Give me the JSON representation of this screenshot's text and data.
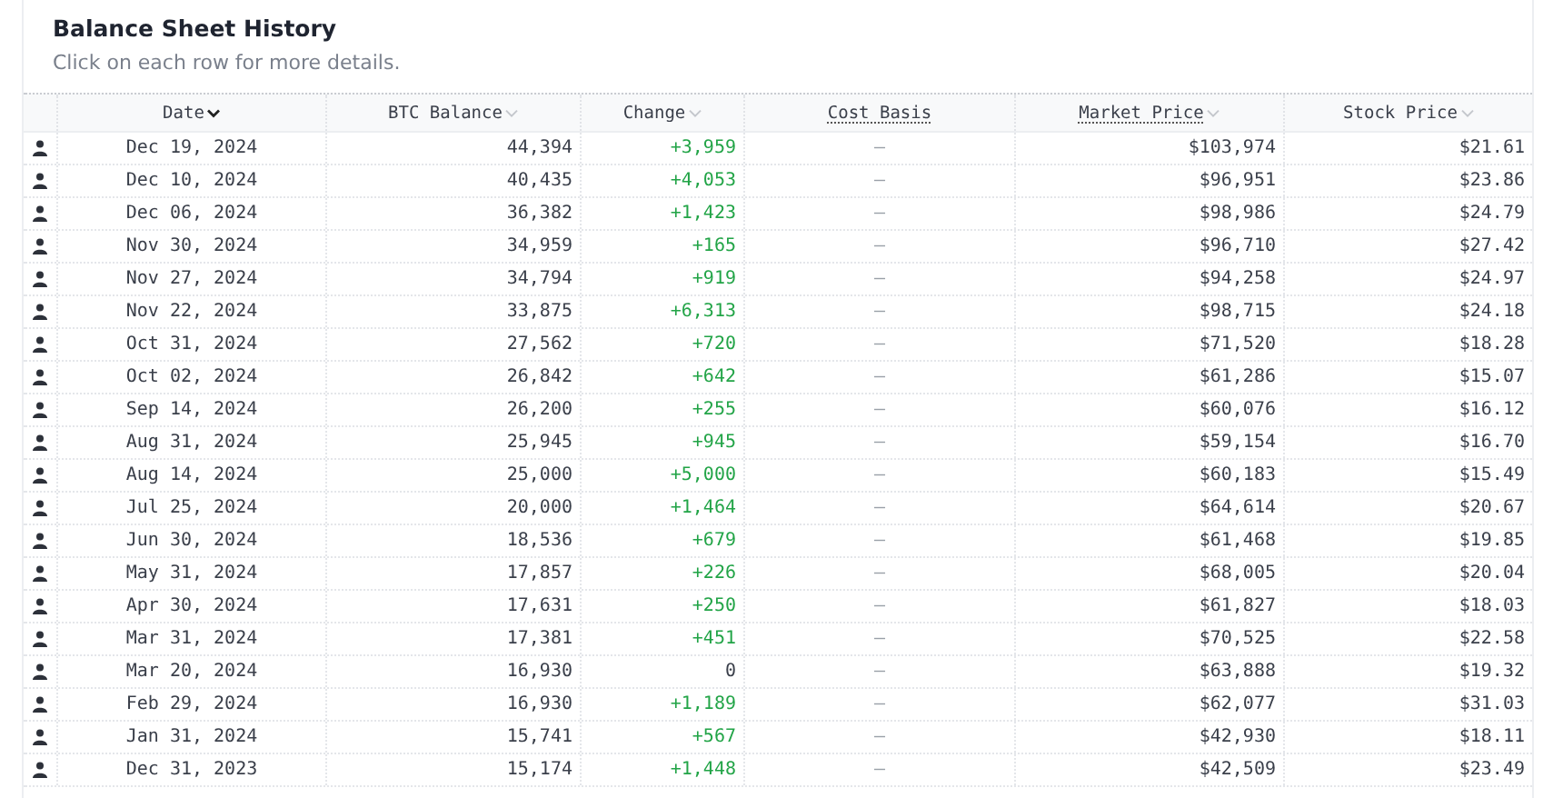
{
  "title": "Balance Sheet History",
  "subtitle": "Click on each row for more details.",
  "columns": [
    {
      "label": "Date",
      "sortable": true,
      "sorted": true,
      "underlined": false
    },
    {
      "label": "BTC Balance",
      "sortable": true,
      "sorted": false,
      "underlined": false
    },
    {
      "label": "Change",
      "sortable": true,
      "sorted": false,
      "underlined": false
    },
    {
      "label": "Cost Basis",
      "sortable": false,
      "underlined": true
    },
    {
      "label": "Market Price",
      "sortable": true,
      "sorted": false,
      "underlined": true
    },
    {
      "label": "Stock Price",
      "sortable": true,
      "sorted": false,
      "underlined": false
    }
  ],
  "rows": [
    {
      "date": "Dec 19, 2024",
      "balance": "44,394",
      "change": "+3,959",
      "color": "#22a447",
      "cost_basis": "—",
      "market_price": "$103,974",
      "stock_price": "$21.61"
    },
    {
      "date": "Dec 10, 2024",
      "balance": "40,435",
      "change": "+4,053",
      "color": "#22a447",
      "cost_basis": "—",
      "market_price": "$96,951",
      "stock_price": "$23.86"
    },
    {
      "date": "Dec 06, 2024",
      "balance": "36,382",
      "change": "+1,423",
      "color": "#22a447",
      "cost_basis": "—",
      "market_price": "$98,986",
      "stock_price": "$24.79"
    },
    {
      "date": "Nov 30, 2024",
      "balance": "34,959",
      "change": "+165",
      "color": "#22a447",
      "cost_basis": "—",
      "market_price": "$96,710",
      "stock_price": "$27.42"
    },
    {
      "date": "Nov 27, 2024",
      "balance": "34,794",
      "change": "+919",
      "color": "#22a447",
      "cost_basis": "—",
      "market_price": "$94,258",
      "stock_price": "$24.97"
    },
    {
      "date": "Nov 22, 2024",
      "balance": "33,875",
      "change": "+6,313",
      "color": "#22a447",
      "cost_basis": "—",
      "market_price": "$98,715",
      "stock_price": "$24.18"
    },
    {
      "date": "Oct 31, 2024",
      "balance": "27,562",
      "change": "+720",
      "color": "#22a447",
      "cost_basis": "—",
      "market_price": "$71,520",
      "stock_price": "$18.28"
    },
    {
      "date": "Oct 02, 2024",
      "balance": "26,842",
      "change": "+642",
      "color": "#22a447",
      "cost_basis": "—",
      "market_price": "$61,286",
      "stock_price": "$15.07"
    },
    {
      "date": "Sep 14, 2024",
      "balance": "26,200",
      "change": "+255",
      "color": "#22a447",
      "cost_basis": "—",
      "market_price": "$60,076",
      "stock_price": "$16.12"
    },
    {
      "date": "Aug 31, 2024",
      "balance": "25,945",
      "change": "+945",
      "color": "#22a447",
      "cost_basis": "—",
      "market_price": "$59,154",
      "stock_price": "$16.70"
    },
    {
      "date": "Aug 14, 2024",
      "balance": "25,000",
      "change": "+5,000",
      "color": "#22a447",
      "cost_basis": "—",
      "market_price": "$60,183",
      "stock_price": "$15.49"
    },
    {
      "date": "Jul 25, 2024",
      "balance": "20,000",
      "change": "+1,464",
      "color": "#22a447",
      "cost_basis": "—",
      "market_price": "$64,614",
      "stock_price": "$20.67"
    },
    {
      "date": "Jun 30, 2024",
      "balance": "18,536",
      "change": "+679",
      "color": "#22a447",
      "cost_basis": "—",
      "market_price": "$61,468",
      "stock_price": "$19.85"
    },
    {
      "date": "May 31, 2024",
      "balance": "17,857",
      "change": "+226",
      "color": "#22a447",
      "cost_basis": "—",
      "market_price": "$68,005",
      "stock_price": "$20.04"
    },
    {
      "date": "Apr 30, 2024",
      "balance": "17,631",
      "change": "+250",
      "color": "#22a447",
      "cost_basis": "—",
      "market_price": "$61,827",
      "stock_price": "$18.03"
    },
    {
      "date": "Mar 31, 2024",
      "balance": "17,381",
      "change": "+451",
      "color": "#22a447",
      "cost_basis": "—",
      "market_price": "$70,525",
      "stock_price": "$22.58"
    },
    {
      "date": "Mar 20, 2024",
      "balance": "16,930",
      "change": "0",
      "color": "#3a3f4a",
      "cost_basis": "—",
      "market_price": "$63,888",
      "stock_price": "$19.32"
    },
    {
      "date": "Feb 29, 2024",
      "balance": "16,930",
      "change": "+1,189",
      "color": "#22a447",
      "cost_basis": "—",
      "market_price": "$62,077",
      "stock_price": "$31.03"
    },
    {
      "date": "Jan 31, 2024",
      "balance": "15,741",
      "change": "+567",
      "color": "#22a447",
      "cost_basis": "—",
      "market_price": "$42,930",
      "stock_price": "$18.11"
    },
    {
      "date": "Dec 31, 2023",
      "balance": "15,174",
      "change": "+1,448",
      "color": "#22a447",
      "cost_basis": "—",
      "market_price": "$42,509",
      "stock_price": "$23.49"
    }
  ]
}
